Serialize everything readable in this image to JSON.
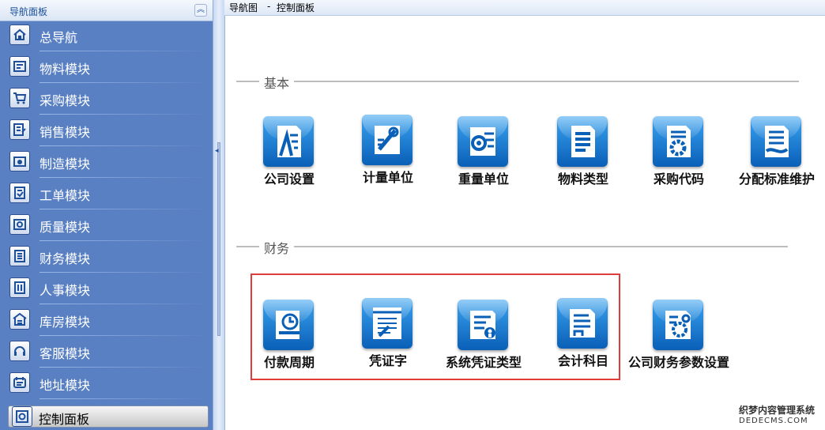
{
  "nav": {
    "title": "导航面板",
    "collapse_glyph": "≈",
    "items": [
      {
        "label": "总导航",
        "icon": "home-icon"
      },
      {
        "label": "物料模块",
        "icon": "material-icon"
      },
      {
        "label": "采购模块",
        "icon": "cart-icon"
      },
      {
        "label": "销售模块",
        "icon": "sales-icon"
      },
      {
        "label": "制造模块",
        "icon": "manufacture-icon"
      },
      {
        "label": "工单模块",
        "icon": "work-order-icon"
      },
      {
        "label": "质量模块",
        "icon": "quality-icon"
      },
      {
        "label": "财务模块",
        "icon": "finance-icon"
      },
      {
        "label": "人事模块",
        "icon": "hr-icon"
      },
      {
        "label": "库房模块",
        "icon": "warehouse-icon"
      },
      {
        "label": "客服模块",
        "icon": "customer-service-icon"
      },
      {
        "label": "地址模块",
        "icon": "address-icon"
      },
      {
        "label": "控制面板",
        "icon": "control-panel-icon",
        "active": true
      }
    ]
  },
  "breadcrumb": {
    "root": "导航图",
    "separator": "-",
    "current": "控制面板"
  },
  "sections": [
    {
      "title": "基本",
      "tiles": [
        {
          "label": "公司设置",
          "icon": "company-settings-icon"
        },
        {
          "label": "计量单位",
          "icon": "measure-unit-icon"
        },
        {
          "label": "重量单位",
          "icon": "weight-unit-icon"
        },
        {
          "label": "物料类型",
          "icon": "material-type-icon"
        },
        {
          "label": "采购代码",
          "icon": "purchase-code-icon"
        },
        {
          "label": "分配标准维护",
          "icon": "allocation-standard-icon"
        }
      ]
    },
    {
      "title": "财务",
      "tiles": [
        {
          "label": "付款周期",
          "icon": "payment-cycle-icon"
        },
        {
          "label": "凭证字",
          "icon": "voucher-word-icon"
        },
        {
          "label": "系统凭证类型",
          "icon": "voucher-type-icon"
        },
        {
          "label": "会计科目",
          "icon": "account-subject-icon"
        },
        {
          "label": "公司财务参数设置",
          "icon": "finance-params-icon"
        }
      ]
    }
  ],
  "watermark": {
    "line1": "织梦内容管理系统",
    "line2": "DEDECMS.COM"
  },
  "colors": {
    "nav_background": "#5a80c4",
    "tile_blue": "#0a5fb7",
    "highlight_red": "#e03c3c"
  }
}
